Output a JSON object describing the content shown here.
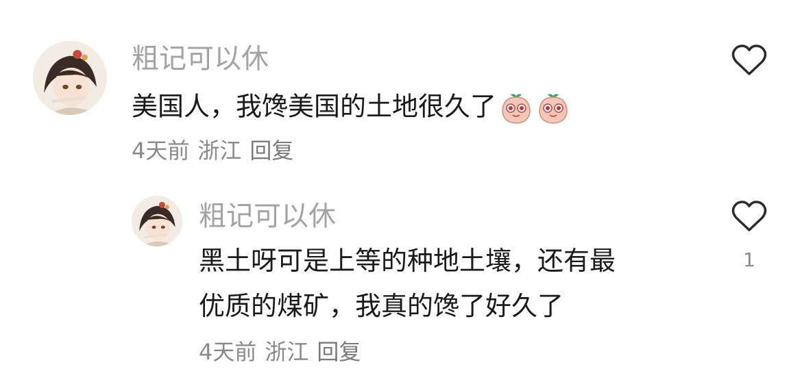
{
  "comments": [
    {
      "username": "粗记可以休",
      "text": "美国人，我馋美国的土地很久了",
      "emojis": [
        "peach-eyes-emoji",
        "peach-eyes-emoji"
      ],
      "time": "4天前",
      "location": "浙江",
      "reply_label": "回复",
      "likes": ""
    },
    {
      "username": "粗记可以休",
      "text_line1": "黑土呀可是上等的种地土壤，还有最",
      "text_line2": "优质的煤矿，我真的馋了好久了",
      "time": "4天前",
      "location": "浙江",
      "reply_label": "回复",
      "likes": "1"
    }
  ],
  "colors": {
    "username": "#a3a3a3",
    "comment_text": "#1a1a1a",
    "meta": "#8a8a8a",
    "heart_stroke": "#2b2b2b"
  },
  "icons": [
    "heart-outline-icon",
    "avatar-anime-character"
  ]
}
